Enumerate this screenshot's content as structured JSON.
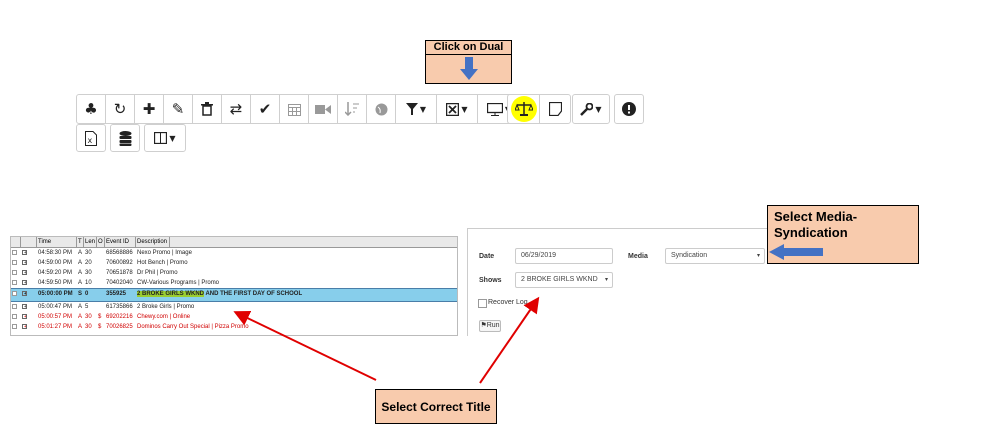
{
  "callouts": {
    "dual": "Click on Dual",
    "media": "Select Media-Syndication",
    "title": "Select Correct Title"
  },
  "toolbar": {
    "row1": [
      {
        "name": "tree-icon",
        "glyph": "♣"
      },
      {
        "name": "refresh-icon",
        "glyph": "↻"
      },
      {
        "name": "plus-icon",
        "glyph": "✚"
      },
      {
        "name": "edit-icon",
        "glyph": "✎"
      },
      {
        "name": "trash-icon",
        "glyph": "🗑"
      },
      {
        "name": "swap-icon",
        "glyph": "⇄"
      },
      {
        "name": "check-icon",
        "glyph": "✔"
      },
      {
        "name": "calendar-icon",
        "glyph": "▦"
      },
      {
        "name": "video-icon",
        "glyph": "■"
      },
      {
        "name": "sort-icon",
        "glyph": "↓"
      },
      {
        "name": "globe-icon",
        "glyph": "●"
      }
    ],
    "extra_icons": [
      "filter-icon",
      "close-box-icon",
      "monitor-icon",
      "scales-icon",
      "note-icon",
      "wrench-icon",
      "alert-icon"
    ]
  },
  "grid": {
    "headers": [
      "Time",
      "T",
      "Len",
      "O",
      "Event ID",
      "Description"
    ],
    "rows": [
      {
        "time": "04:58:30 PM",
        "t": "A",
        "len": "30",
        "o": "",
        "id": "68568886",
        "desc": "Nexo Promo | Image",
        "cls": ""
      },
      {
        "time": "04:59:00 PM",
        "t": "A",
        "len": "20",
        "o": "",
        "id": "70600892",
        "desc": "Hot Bench | Promo",
        "cls": ""
      },
      {
        "time": "04:59:20 PM",
        "t": "A",
        "len": "30",
        "o": "",
        "id": "70651878",
        "desc": "Dr Phil | Promo",
        "cls": ""
      },
      {
        "time": "04:59:50 PM",
        "t": "A",
        "len": "10",
        "o": "",
        "id": "70402040",
        "desc": "CW-Various Programs | Promo",
        "cls": ""
      },
      {
        "time": "05:00:00 PM",
        "t": "S",
        "len": "0",
        "o": "",
        "id": "355925",
        "desc_hl": "2 BROKE GIRLS WKND",
        "desc_rest": " AND THE FIRST DAY OF SCHOOL",
        "cls": "sel"
      },
      {
        "time": "05:00:47 PM",
        "t": "A",
        "len": "5",
        "o": "",
        "id": "61735866",
        "desc": "2 Broke Girls | Promo",
        "cls": ""
      },
      {
        "time": "05:00:57 PM",
        "t": "A",
        "len": "30",
        "o": "$",
        "id": "69202216",
        "desc": "Chewy.com | Online",
        "cls": "red"
      },
      {
        "time": "05:01:27 PM",
        "t": "A",
        "len": "30",
        "o": "$",
        "id": "70026825",
        "desc": "Dominos Carry Out Special | Pizza Promo",
        "cls": "red"
      }
    ]
  },
  "form": {
    "date_label": "Date",
    "date_value": "06/29/2019",
    "media_label": "Media",
    "media_value": "Syndication",
    "shows_label": "Shows",
    "shows_value": "2 BROKE GIRLS WKND",
    "recover_label": "Recover Log",
    "run_label": "Run"
  }
}
